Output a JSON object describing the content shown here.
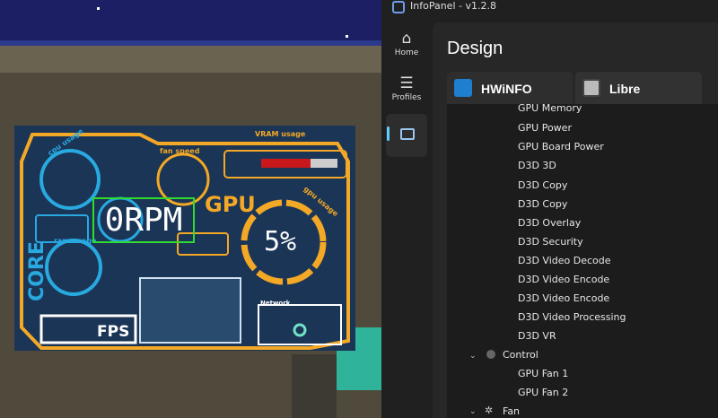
{
  "panel": {
    "rpm": "0RPM",
    "gpu_label": "GPU",
    "gpu_usage": "5%",
    "core_label": "CORE",
    "fps_label": "FPS",
    "vram_label": "VRAM usage",
    "vram_fraction": 0.65,
    "network_label": "Network",
    "cpu_usage_label": "cpu usage",
    "fan_speed_label": "fan speed",
    "ram_usage_label": "ram usage",
    "gpu_usage_label": "gpu usage"
  },
  "app": {
    "title": "InfoPanel - v1.2.8",
    "nav": [
      {
        "label": "Home",
        "icon": "home-icon"
      },
      {
        "label": "Profiles",
        "icon": "menu-icon"
      },
      {
        "label": "",
        "icon": "design-icon"
      }
    ],
    "page_title": "Design",
    "tabs": [
      {
        "label": "HWiNFO",
        "selected": true
      },
      {
        "label": "Libre",
        "selected": false
      }
    ],
    "tree": {
      "items": [
        "GPU Memory",
        "GPU Power",
        "GPU Board Power",
        "D3D 3D",
        "D3D Copy",
        "D3D Copy",
        "D3D Overlay",
        "D3D Security",
        "D3D Video Decode",
        "D3D Video Encode",
        "D3D Video Encode",
        "D3D Video Processing",
        "D3D VR"
      ],
      "groups": [
        {
          "label": "Control",
          "icon": "control-knob-icon",
          "items": [
            "GPU Fan 1",
            "GPU Fan 2"
          ]
        },
        {
          "label": "Fan",
          "icon": "fan-icon",
          "items": []
        }
      ]
    }
  }
}
